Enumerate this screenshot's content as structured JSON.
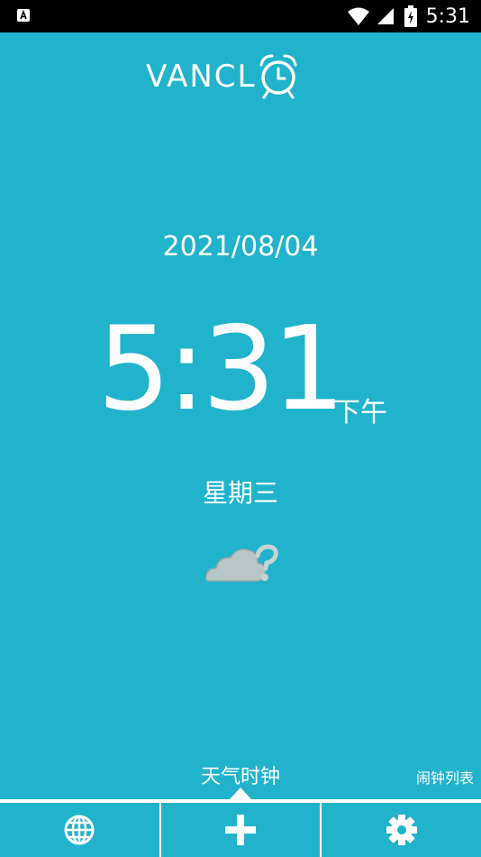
{
  "status_bar": {
    "time": "5:31"
  },
  "header": {
    "logo_text": "VANCL"
  },
  "clock": {
    "date": "2021/08/04",
    "time": "5:31",
    "ampm": "下午",
    "weekday": "星期三"
  },
  "tabs": {
    "weather_clock": "天气时钟",
    "alarm_list": "闹钟列表"
  },
  "bottom_bar": {
    "icons": [
      "globe-icon",
      "plus-icon",
      "gear-icon"
    ]
  },
  "colors": {
    "background": "#21b3cc",
    "foreground": "#ffffff",
    "status_bar": "#000000",
    "cloud": "#b8c6c8"
  }
}
